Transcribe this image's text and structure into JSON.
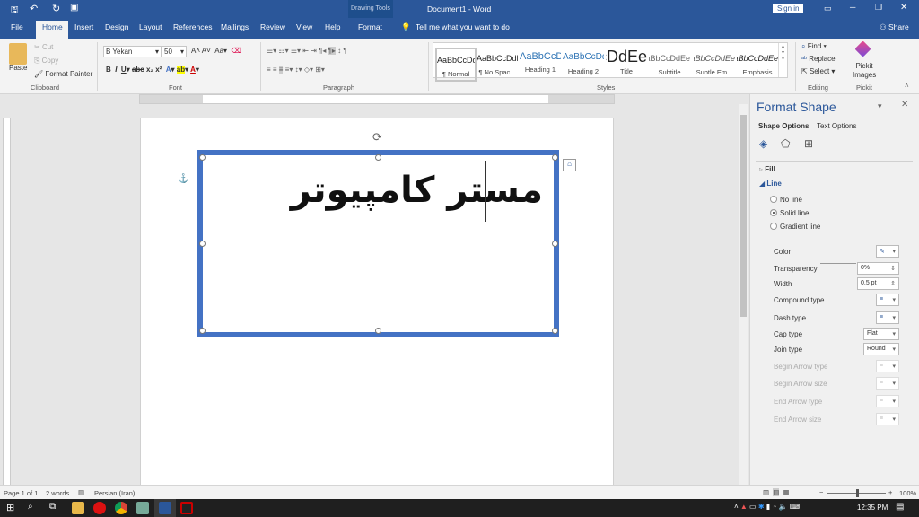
{
  "window": {
    "title": "Document1 - Word",
    "context_tab_group": "Drawing Tools",
    "sign_in": "Sign in",
    "share": "Share"
  },
  "tabs": [
    "File",
    "Home",
    "Insert",
    "Design",
    "Layout",
    "References",
    "Mailings",
    "Review",
    "View",
    "Help",
    "Format"
  ],
  "tell_me": "Tell me what you want to do",
  "clipboard": {
    "paste": "Paste",
    "cut": "Cut",
    "copy": "Copy",
    "format_painter": "Format Painter",
    "group": "Clipboard"
  },
  "font": {
    "name": "B Yekan",
    "size": "50",
    "group": "Font"
  },
  "paragraph": {
    "group": "Paragraph"
  },
  "styles": {
    "group": "Styles",
    "items": [
      {
        "preview": "AaBbCcDdEe",
        "label": "¶ Normal"
      },
      {
        "preview": "AaBbCcDdEe",
        "label": "¶ No Spac..."
      },
      {
        "preview": "AaBbCcDdEe",
        "label": "Heading 1"
      },
      {
        "preview": "AaBbCcDdEe",
        "label": "Heading 2"
      },
      {
        "preview": "AaBbCcDdEe",
        "label": "Title"
      },
      {
        "preview": "AaBbCcDdEe",
        "label": "Subtitle"
      },
      {
        "preview": "AaBbCcDdEe",
        "label": "Subtle Em..."
      },
      {
        "preview": "AaBbCcDdEe",
        "label": "Emphasis"
      }
    ]
  },
  "editing": {
    "find": "Find",
    "replace": "Replace",
    "select": "Select",
    "group": "Editing"
  },
  "pickit": {
    "label": "Pickit Images",
    "group": "Pickit"
  },
  "document": {
    "shape_text": "مستر کامپیوتر"
  },
  "pane": {
    "title": "Format Shape",
    "tabs": [
      "Shape Options",
      "Text Options"
    ],
    "fill": "Fill",
    "line": "Line",
    "line_options": [
      {
        "label": "No line",
        "selected": false
      },
      {
        "label": "Solid line",
        "selected": true
      },
      {
        "label": "Gradient line",
        "selected": false
      }
    ],
    "props": [
      {
        "label": "Color",
        "value": ""
      },
      {
        "label": "Transparency",
        "value": "0%"
      },
      {
        "label": "Width",
        "value": "0.5 pt"
      },
      {
        "label": "Compound type",
        "value": ""
      },
      {
        "label": "Dash type",
        "value": ""
      },
      {
        "label": "Cap type",
        "value": "Flat"
      },
      {
        "label": "Join type",
        "value": "Round"
      },
      {
        "label": "Begin Arrow type",
        "value": ""
      },
      {
        "label": "Begin Arrow size",
        "value": ""
      },
      {
        "label": "End Arrow type",
        "value": ""
      },
      {
        "label": "End Arrow size",
        "value": ""
      }
    ]
  },
  "status": {
    "page": "Page 1 of 1",
    "words": "2 words",
    "language": "Persian (Iran)",
    "zoom": "100%"
  },
  "taskbar": {
    "time": "12:35 PM"
  },
  "colors": {
    "accent": "#2b579a",
    "shape_border": "#4472c4"
  }
}
